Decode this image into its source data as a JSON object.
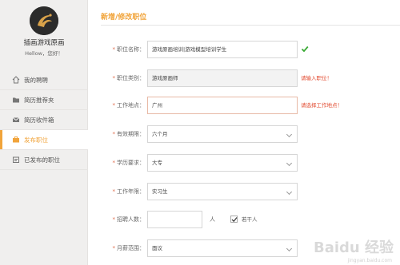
{
  "user": {
    "name": "插画游戏原画",
    "greeting": "Hellow，您好！"
  },
  "sidebar": {
    "items": [
      {
        "label": "我的聘聘",
        "icon": "home-icon"
      },
      {
        "label": "简历推荐夹",
        "icon": "folder-icon"
      },
      {
        "label": "简历收件箱",
        "icon": "inbox-icon"
      },
      {
        "label": "发布职位",
        "icon": "publish-icon",
        "active": true
      },
      {
        "label": "已发布的职位",
        "icon": "published-icon"
      }
    ]
  },
  "page": {
    "title": "新增/修改职位"
  },
  "form": {
    "job_name": {
      "label": "职位名称：",
      "value": "游戏原画培训|游戏模型培训学生"
    },
    "job_type": {
      "label": "职位类别：",
      "value": "游戏原画师",
      "error": "请输入职位！"
    },
    "location": {
      "label": "工作地点：",
      "value": "广州",
      "error": "请选择工作地点！"
    },
    "validity": {
      "label": "有效期限：",
      "value": "六个月"
    },
    "education": {
      "label": "学历要求：",
      "value": "大专"
    },
    "experience": {
      "label": "工作年限：",
      "value": "实习生"
    },
    "headcount": {
      "label": "招聘人数：",
      "value": "",
      "unit": "人",
      "checkbox_label": "若干人",
      "checked": true
    },
    "salary": {
      "label": "月薪范围：",
      "value": "面议"
    }
  },
  "watermark": {
    "text": "Baidu 经验",
    "sub": "jingyan.baidu.com"
  },
  "colors": {
    "accent": "#f1a43b",
    "error": "#e24a2f",
    "check": "#3aaa35",
    "sidebar_bg": "#f0efee"
  }
}
